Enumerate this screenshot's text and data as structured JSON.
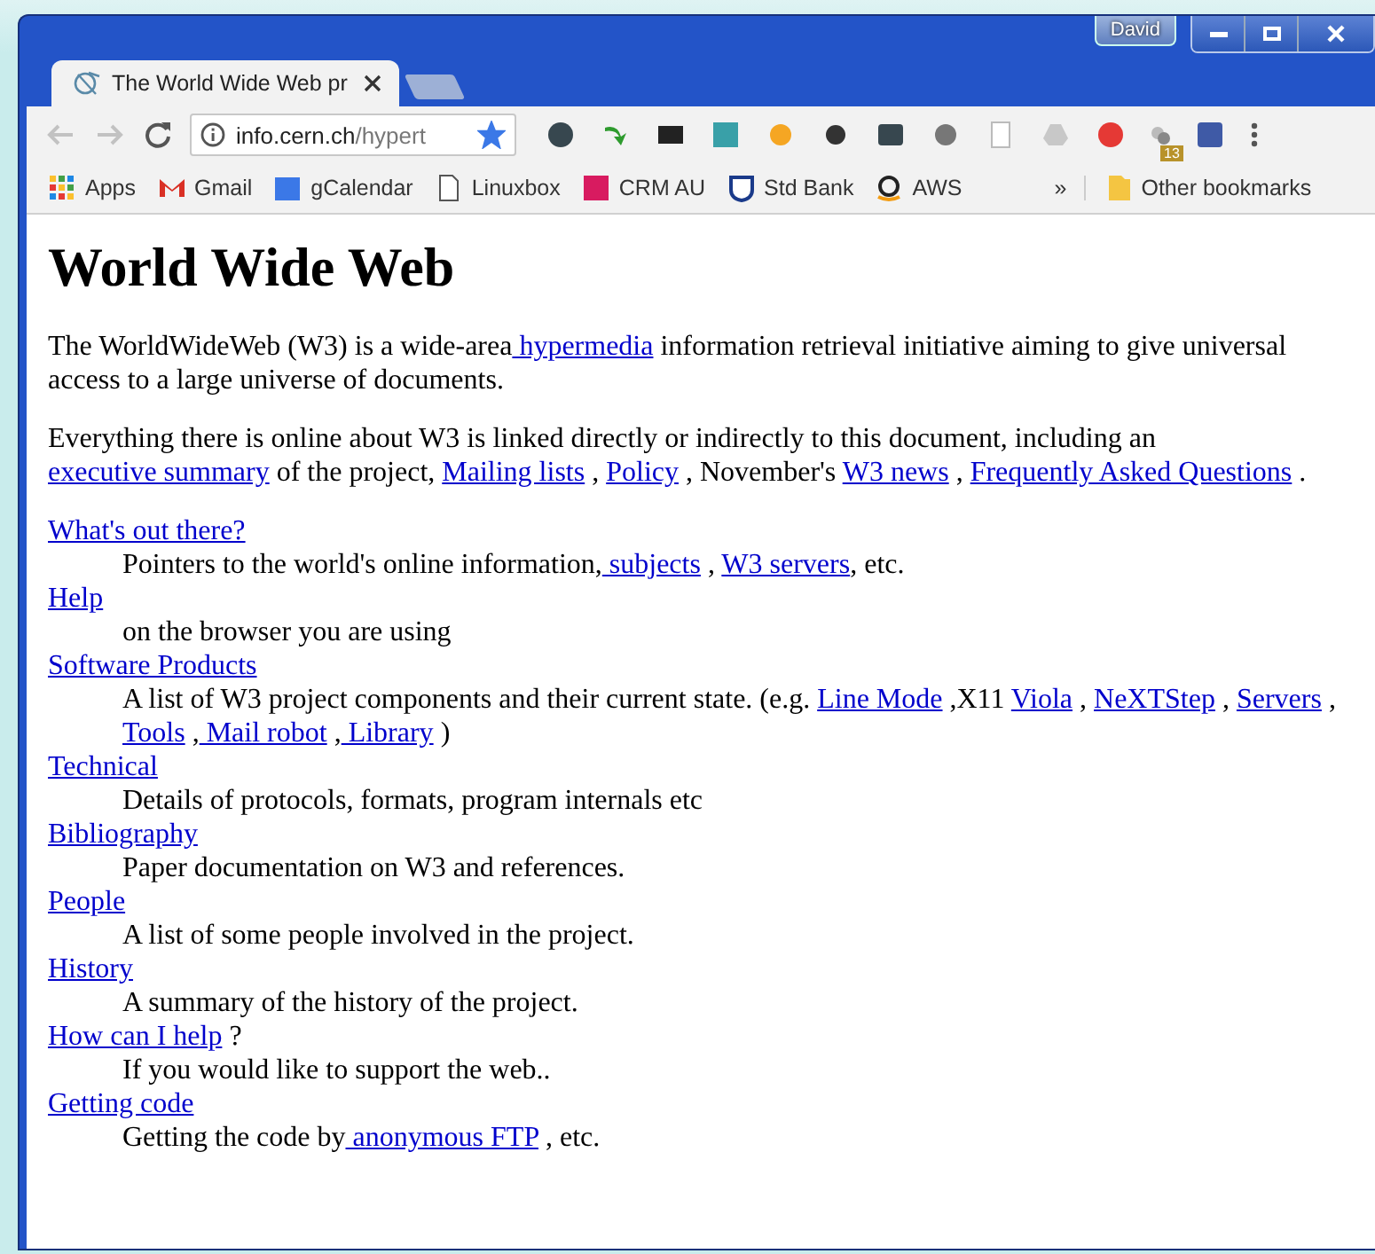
{
  "window": {
    "user": "David"
  },
  "tab": {
    "title": "The World Wide Web pr",
    "selected": true
  },
  "address": {
    "url_host": "info.cern.ch",
    "url_path": "/hypert",
    "bookmarked": true
  },
  "bookmarks": [
    {
      "label": "Apps",
      "kind": "apps"
    },
    {
      "label": "Gmail",
      "kind": "gmail"
    },
    {
      "label": "gCalendar",
      "kind": "calendar"
    },
    {
      "label": "Linuxbox",
      "kind": "page"
    },
    {
      "label": "CRM AU",
      "kind": "crm"
    },
    {
      "label": "Std Bank",
      "kind": "bank"
    },
    {
      "label": "AWS",
      "kind": "amazon"
    }
  ],
  "bookmarks_overflow": "»",
  "other_bookmarks": "Other bookmarks",
  "extension_badge": "13",
  "page": {
    "heading": "World Wide Web",
    "paragraphs": [
      [
        {
          "text": "The WorldWideWeb (W3) is a wide-area",
          "link": false
        },
        {
          "text": " hypermedia",
          "link": true
        },
        {
          "text": " information retrieval initiative aiming to give universal access to a large universe of documents.",
          "link": false
        }
      ],
      [
        {
          "text": "Everything there is online about W3 is linked directly or indirectly to this document, including an ",
          "link": false
        },
        {
          "text": "executive summary",
          "link": true
        },
        {
          "text": " of the project, ",
          "link": false
        },
        {
          "text": "Mailing lists",
          "link": true
        },
        {
          "text": " , ",
          "link": false
        },
        {
          "text": "Policy",
          "link": true
        },
        {
          "text": " , November's ",
          "link": false
        },
        {
          "text": "W3 news",
          "link": true
        },
        {
          "text": " , ",
          "link": false
        },
        {
          "text": "Frequently Asked Questions",
          "link": true
        },
        {
          "text": " .",
          "link": false
        }
      ]
    ],
    "entries": [
      {
        "term": [
          {
            "text": "What's out there?",
            "link": true
          }
        ],
        "description": [
          {
            "text": "Pointers to the world's online information,",
            "link": false
          },
          {
            "text": " subjects",
            "link": true
          },
          {
            "text": " , ",
            "link": false
          },
          {
            "text": "W3 servers",
            "link": true
          },
          {
            "text": ", etc.",
            "link": false
          }
        ]
      },
      {
        "term": [
          {
            "text": "Help",
            "link": true
          }
        ],
        "description": [
          {
            "text": "on the browser you are using",
            "link": false
          }
        ]
      },
      {
        "term": [
          {
            "text": "Software Products",
            "link": true
          }
        ],
        "description": [
          {
            "text": "A list of W3 project components and their current state. (e.g. ",
            "link": false
          },
          {
            "text": "Line Mode",
            "link": true
          },
          {
            "text": " ,X11 ",
            "link": false
          },
          {
            "text": "Viola",
            "link": true
          },
          {
            "text": " , ",
            "link": false
          },
          {
            "text": "NeXTStep",
            "link": true
          },
          {
            "text": " , ",
            "link": false
          },
          {
            "text": "Servers",
            "link": true
          },
          {
            "text": " , ",
            "link": false
          },
          {
            "text": "Tools",
            "link": true
          },
          {
            "text": " ,",
            "link": false
          },
          {
            "text": " Mail robot",
            "link": true
          },
          {
            "text": " ,",
            "link": false
          },
          {
            "text": " Library",
            "link": true
          },
          {
            "text": " )",
            "link": false
          }
        ]
      },
      {
        "term": [
          {
            "text": "Technical",
            "link": true
          }
        ],
        "description": [
          {
            "text": "Details of protocols, formats, program internals etc",
            "link": false
          }
        ]
      },
      {
        "term": [
          {
            "text": "Bibliography",
            "link": true
          }
        ],
        "description": [
          {
            "text": "Paper documentation on W3 and references.",
            "link": false
          }
        ]
      },
      {
        "term": [
          {
            "text": "People",
            "link": true
          }
        ],
        "description": [
          {
            "text": "A list of some people involved in the project.",
            "link": false
          }
        ]
      },
      {
        "term": [
          {
            "text": "History",
            "link": true
          }
        ],
        "description": [
          {
            "text": "A summary of the history of the project.",
            "link": false
          }
        ]
      },
      {
        "term": [
          {
            "text": "How can I help",
            "link": true
          },
          {
            "text": " ?",
            "link": false
          }
        ],
        "description": [
          {
            "text": "If you would like to support the web..",
            "link": false
          }
        ]
      },
      {
        "term": [
          {
            "text": "Getting code",
            "link": true
          }
        ],
        "description": [
          {
            "text": "Getting the code by",
            "link": false
          },
          {
            "text": " anonymous FTP",
            "link": true
          },
          {
            "text": " , etc.",
            "link": false
          }
        ]
      }
    ]
  }
}
